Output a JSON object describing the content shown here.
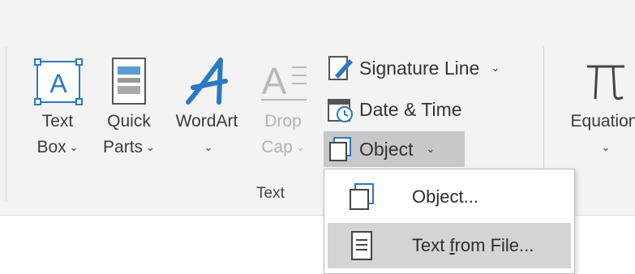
{
  "ribbon": {
    "text_box": {
      "line1": "Text",
      "line2": "Box",
      "icon": "text-box-icon"
    },
    "quick_parts": {
      "line1": "Quick",
      "line2": "Parts",
      "icon": "quick-parts-icon"
    },
    "wordart": {
      "line1": "WordArt",
      "icon": "wordart-icon"
    },
    "drop_cap": {
      "line1": "Drop",
      "line2": "Cap",
      "icon": "drop-cap-icon",
      "disabled": true
    },
    "signature_line": {
      "label": "Signature Line",
      "icon": "signature-line-icon"
    },
    "date_time": {
      "label": "Date & Time",
      "icon": "calendar-clock-icon"
    },
    "object": {
      "label": "Object",
      "icon": "object-icon",
      "active": true
    },
    "equation": {
      "line1": "Equation",
      "icon": "pi-icon"
    },
    "group_label": "Text",
    "chevron": "⌄"
  },
  "dropdown": {
    "items": [
      {
        "label_pre": "Object...",
        "label_u": "",
        "label_post": "",
        "icon": "object-icon",
        "hover": false
      },
      {
        "label_pre": "Text ",
        "label_u": "f",
        "label_post": "rom File...",
        "icon": "document-icon",
        "hover": true
      }
    ]
  },
  "colors": {
    "ribbon_bg": "#f3f3f3",
    "accent_blue": "#2b79c2",
    "active_bg": "#c8c8c8",
    "hover_bg": "#d4d4d4"
  }
}
